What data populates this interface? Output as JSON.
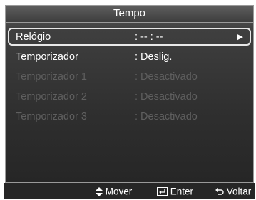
{
  "title": "Tempo",
  "menu_items": [
    {
      "label": "Relógio",
      "value": ": -- : --",
      "selected": true,
      "disabled": false
    },
    {
      "label": "Temporizador",
      "value": ": Deslig.",
      "selected": false,
      "disabled": false
    },
    {
      "label": "Temporizador 1",
      "value": ": Desactivado",
      "selected": false,
      "disabled": true
    },
    {
      "label": "Temporizador 2",
      "value": ": Desactivado",
      "selected": false,
      "disabled": true
    },
    {
      "label": "Temporizador 3",
      "value": ": Desactivado",
      "selected": false,
      "disabled": true
    }
  ],
  "footer": {
    "move_label": "Mover",
    "enter_label": "Enter",
    "back_label": "Voltar",
    "move_icon": "up-down-arrows-icon",
    "enter_icon": "enter-icon",
    "back_icon": "return-icon"
  },
  "colors": {
    "panel": "#2f2f2f",
    "text": "#ffffff",
    "disabled_text": "#5f5f5f",
    "highlight_border": "#e8e8e8"
  }
}
